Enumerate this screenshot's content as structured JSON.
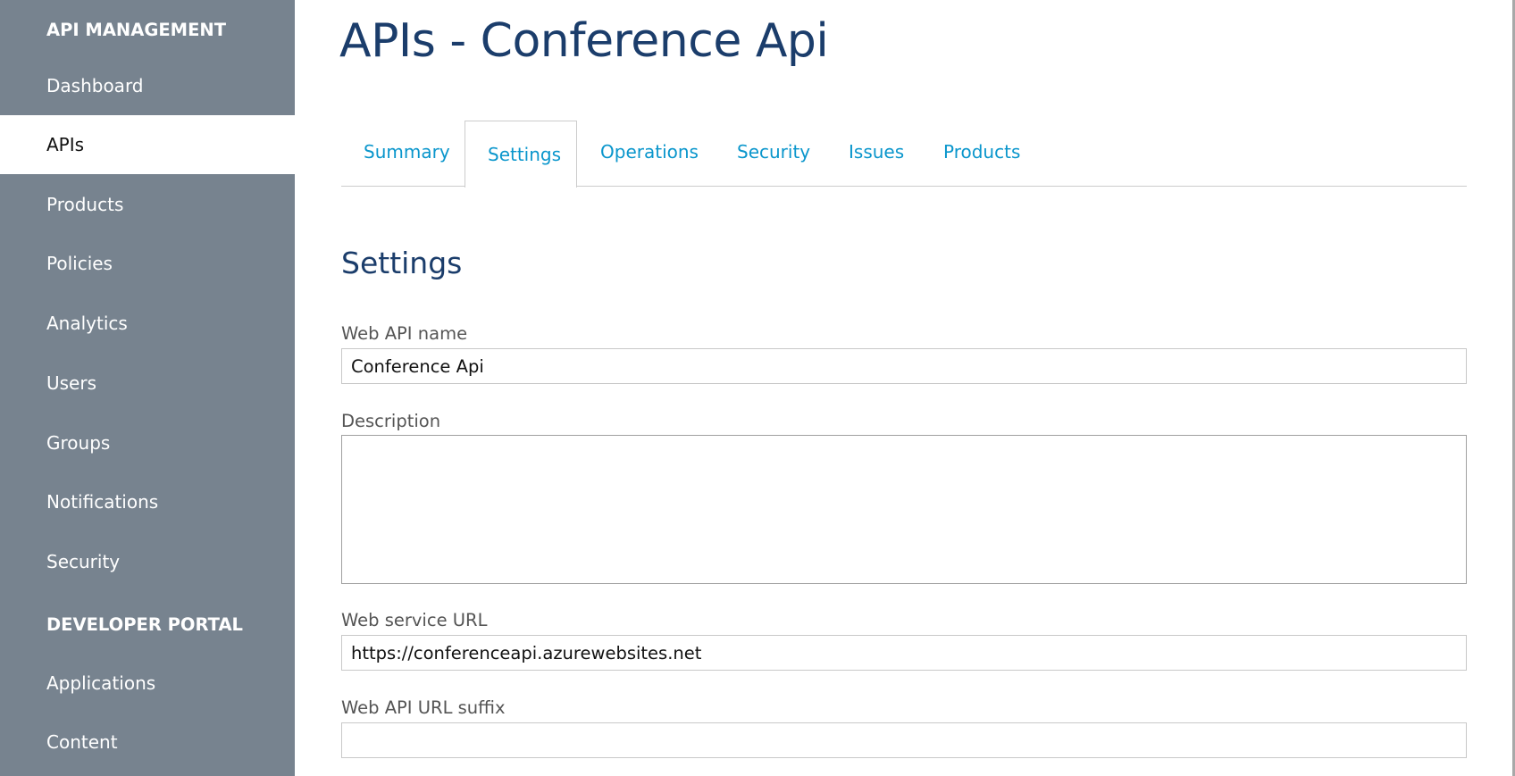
{
  "sidebar": {
    "section1": "API MANAGEMENT",
    "items1": [
      "Dashboard",
      "APIs",
      "Products",
      "Policies",
      "Analytics",
      "Users",
      "Groups",
      "Notifications",
      "Security"
    ],
    "active": "APIs",
    "section2": "DEVELOPER PORTAL",
    "items2": [
      "Applications",
      "Content"
    ]
  },
  "page": {
    "title": "APIs - Conference Api"
  },
  "tabs": [
    "Summary",
    "Settings",
    "Operations",
    "Security",
    "Issues",
    "Products"
  ],
  "active_tab": "Settings",
  "form": {
    "heading": "Settings",
    "name_label": "Web API name",
    "name_value": "Conference Api",
    "desc_label": "Description",
    "desc_value": "",
    "url_label": "Web service URL",
    "url_value": "https://conferenceapi.azurewebsites.net",
    "suffix_label": "Web API URL suffix",
    "suffix_value": ""
  },
  "colors": {
    "sidebar": "#77838f",
    "accent": "#0a96cc",
    "title": "#1b3d6b"
  }
}
